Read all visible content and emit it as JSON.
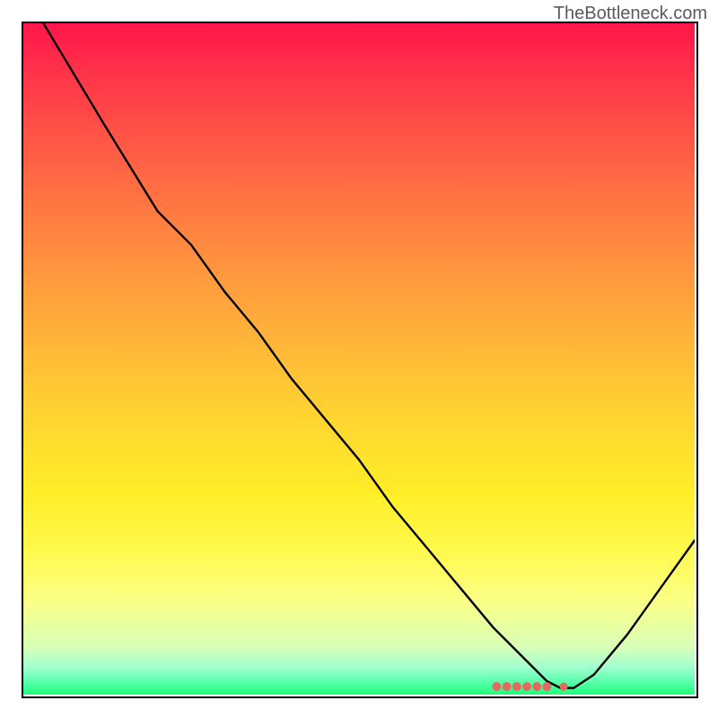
{
  "watermark": "TheBottleneck.com",
  "chart_data": {
    "type": "line",
    "title": "",
    "xlabel": "",
    "ylabel": "",
    "xlim": [
      0,
      100
    ],
    "ylim": [
      0,
      100
    ],
    "series": [
      {
        "name": "bottleneck-curve",
        "x": [
          3,
          12,
          20,
          25,
          30,
          35,
          40,
          45,
          50,
          55,
          60,
          65,
          70,
          75,
          78,
          80,
          82,
          85,
          90,
          95,
          100
        ],
        "y": [
          100,
          85,
          72,
          67,
          60,
          54,
          47,
          41,
          35,
          28,
          22,
          16,
          10,
          5,
          2,
          1,
          1,
          3,
          9,
          16,
          23
        ]
      }
    ],
    "markers": {
      "name": "optimal-range",
      "x": [
        70.5,
        72,
        73.5,
        75,
        76.5,
        78,
        80.5
      ],
      "y": [
        1.2,
        1.2,
        1.2,
        1.2,
        1.2,
        1.2,
        1.2
      ],
      "color": "#e26a5f"
    },
    "colors": {
      "curve": "#000000",
      "marker": "#e26a5f",
      "frame": "#000000"
    }
  }
}
